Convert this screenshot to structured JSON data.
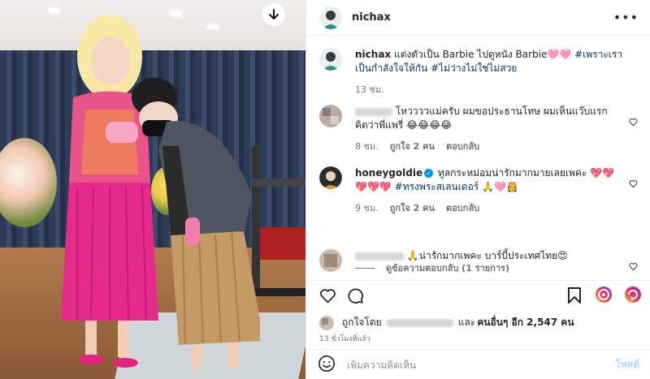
{
  "post": {
    "username": "nichax",
    "more_label": "•••",
    "caption_user": "nichax",
    "caption_text": " แต่งตัวเป็น Barbie ไปดูหนัง Barbie🩷🩷 ",
    "caption_tags": "#เพราะเราเป็นกำลังใจให้กัน #ไม่ว่างไม่ใช่ไม่สวย",
    "caption_time": "13 ชม."
  },
  "comments": [
    {
      "text": "โหววววแม่ครับ ผมขอประธานโทษ ผมเห็นแว๊บแรกคิดว่าพี่แพรี่ 😂😂😂😂",
      "time": "8 ชม.",
      "likes": "ถูกใจ 2 คน",
      "reply": "ตอบกลับ"
    },
    {
      "user": "honeygoldie",
      "verified_mark": "✓",
      "text": " ทูลกระหม่อมน่ารักมากมายเลยเพคะ 💖💖💖💖💖 ",
      "tag": "#ทรงพระสเลนเดอร์",
      "text_end": " 🙏🩷👸",
      "time": "9 ชม.",
      "likes": "ถูกใจ 2 คน",
      "reply": "ตอบกลับ"
    },
    {
      "text": "🙏น่ารักมากเพคะ บาร์บี้ประเทศไทย😍"
    }
  ],
  "view_replies": "ดูข้อความตอบกลับ (1 รายการ)",
  "likes_bar": {
    "liked_by_prefix": "ถูกใจโดย",
    "liked_by_suffix": "และ",
    "others": "คนอื่นๆ อีก 2,547 คน"
  },
  "post_time": "13 ชั่วโมงที่แล้ว",
  "add_comment": {
    "placeholder": "เพิ่มความคิดเห็น",
    "post_label": "โพสต์"
  },
  "colors": {
    "accent": "#0095f6",
    "hashtag": "#00376b",
    "muted": "#737373"
  },
  "icons": [
    "download-icon",
    "more-icon",
    "heart-icon",
    "comment-icon",
    "share-icon",
    "save-icon",
    "emoji-icon"
  ]
}
